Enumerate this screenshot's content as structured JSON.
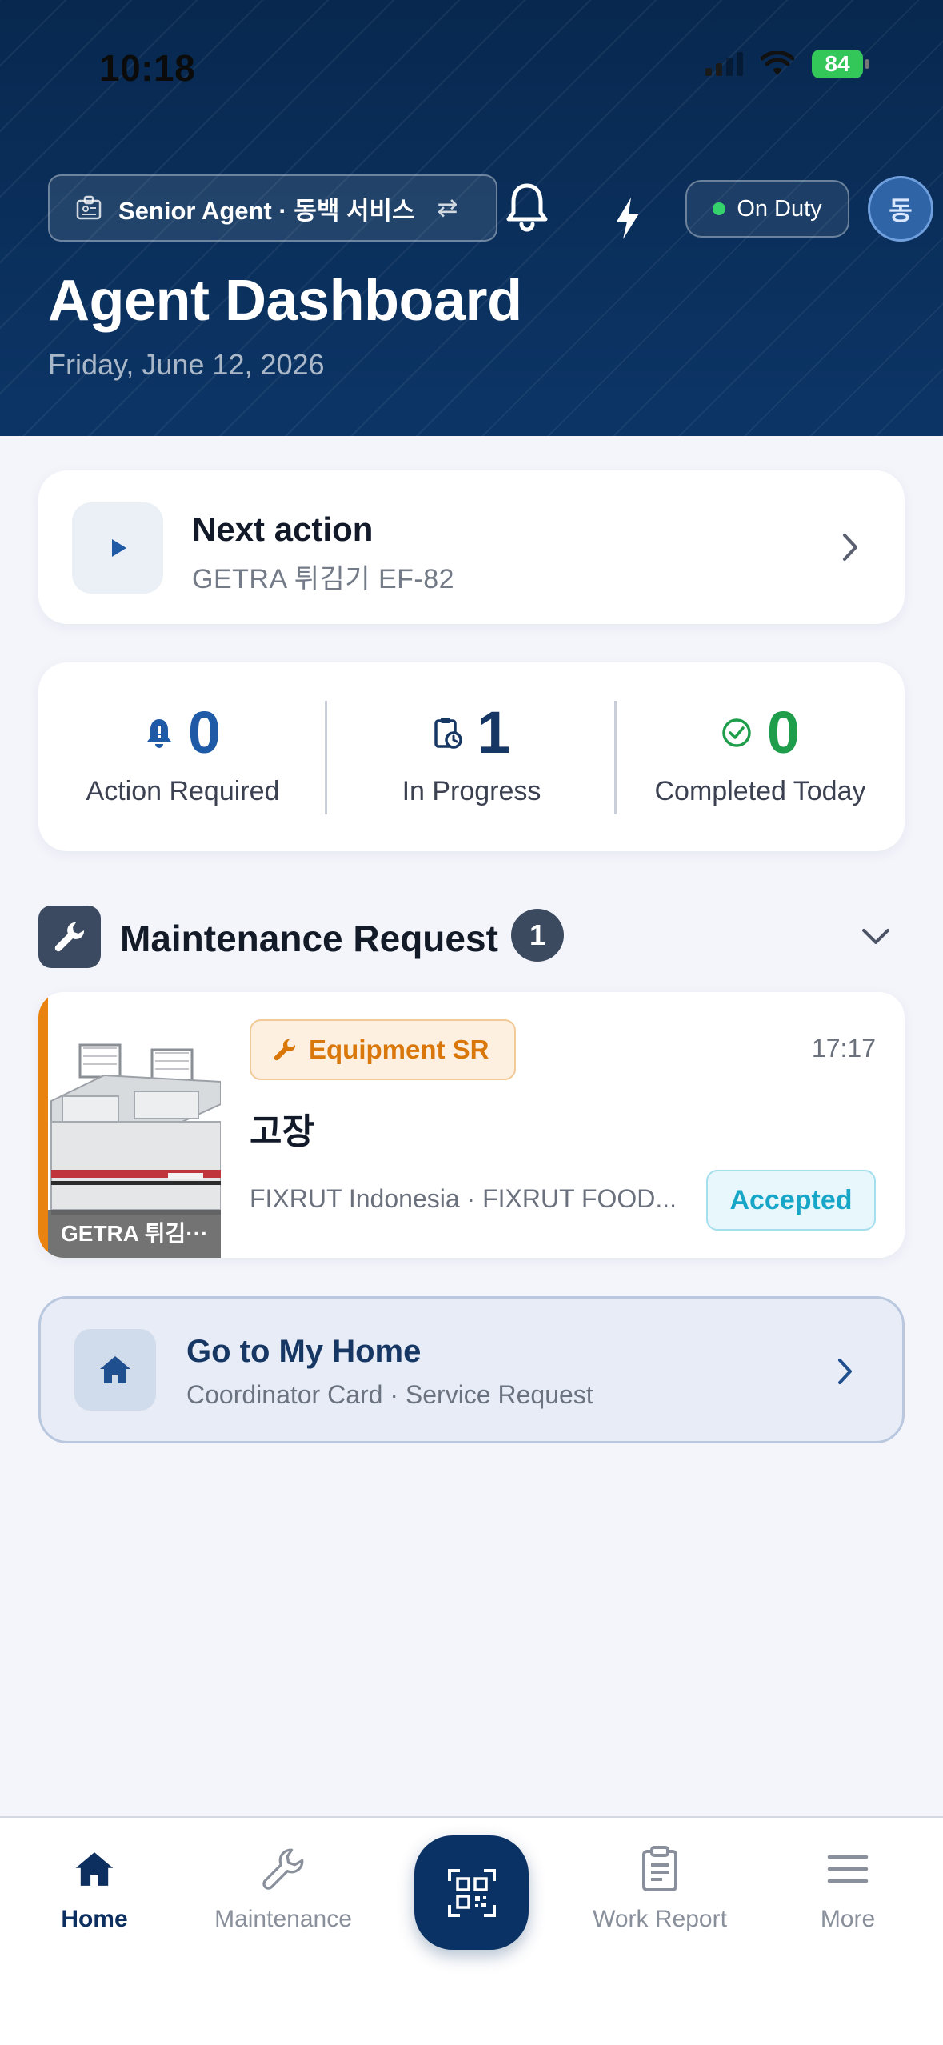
{
  "status_bar": {
    "time": "10:18",
    "battery": "84"
  },
  "header": {
    "role_label": "Senior Agent · 동백 서비스",
    "duty_label": "On Duty",
    "avatar_initial": "동",
    "title": "Agent Dashboard",
    "date": "Friday, June 12, 2026"
  },
  "next_action": {
    "title": "Next action",
    "subtitle": "GETRA 튀김기 EF-82"
  },
  "stats": [
    {
      "value": "0",
      "label": "Action Required",
      "color": "#1f5aa6",
      "icon": "bell-alert-icon"
    },
    {
      "value": "1",
      "label": "In Progress",
      "color": "#163764",
      "icon": "clipboard-clock-icon"
    },
    {
      "value": "0",
      "label": "Completed Today",
      "color": "#1e9e4b",
      "icon": "check-circle-icon"
    }
  ],
  "maintenance": {
    "title": "Maintenance Request",
    "count": "1",
    "request": {
      "type_label": "Equipment SR",
      "time": "17:17",
      "title": "고장",
      "meta": "FIXRUT Indonesia · FIXRUT FOOD...",
      "status": "Accepted",
      "thumb_caption": "GETRA 튀김···"
    }
  },
  "home_link": {
    "title": "Go to My Home",
    "subtitle": "Coordinator Card · Service Request"
  },
  "nav": {
    "home": "Home",
    "maintenance": "Maintenance",
    "work_report": "Work Report",
    "more": "More"
  },
  "colors": {
    "brand": "#0b3264",
    "accent_orange": "#e8830f",
    "status_cyan": "#18a6c8"
  }
}
